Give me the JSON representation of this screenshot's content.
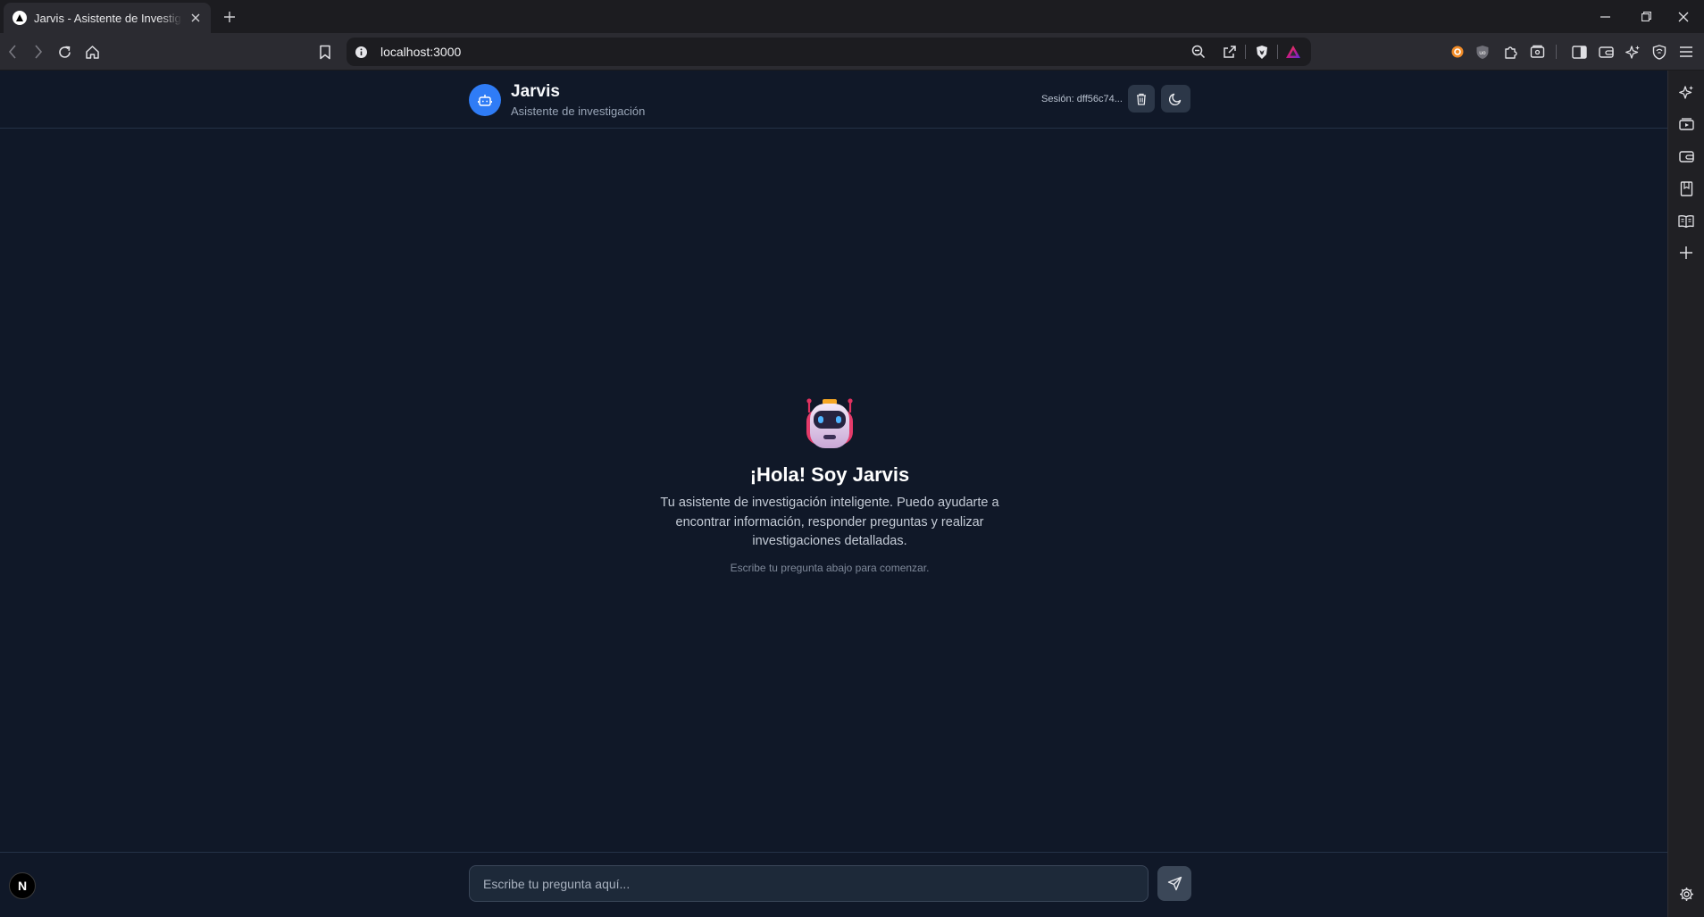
{
  "browser": {
    "tab_title": "Jarvis - Asistente de Investigación",
    "url": "localhost:3000"
  },
  "app": {
    "title": "Jarvis",
    "subtitle": "Asistente de investigación",
    "session_label": "Sesión: dff56c74..."
  },
  "welcome": {
    "title": "¡Hola! Soy Jarvis",
    "description": "Tu asistente de investigación inteligente. Puedo ayudarte a encontrar información, responder preguntas y realizar investigaciones detalladas.",
    "hint": "Escribe tu pregunta abajo para comenzar."
  },
  "chat": {
    "placeholder": "Escribe tu pregunta aquí..."
  },
  "dev_badge": {
    "label": "N"
  },
  "colors": {
    "accent": "#2f7cf6",
    "background": "#101828",
    "input_bg": "#1d2939"
  }
}
